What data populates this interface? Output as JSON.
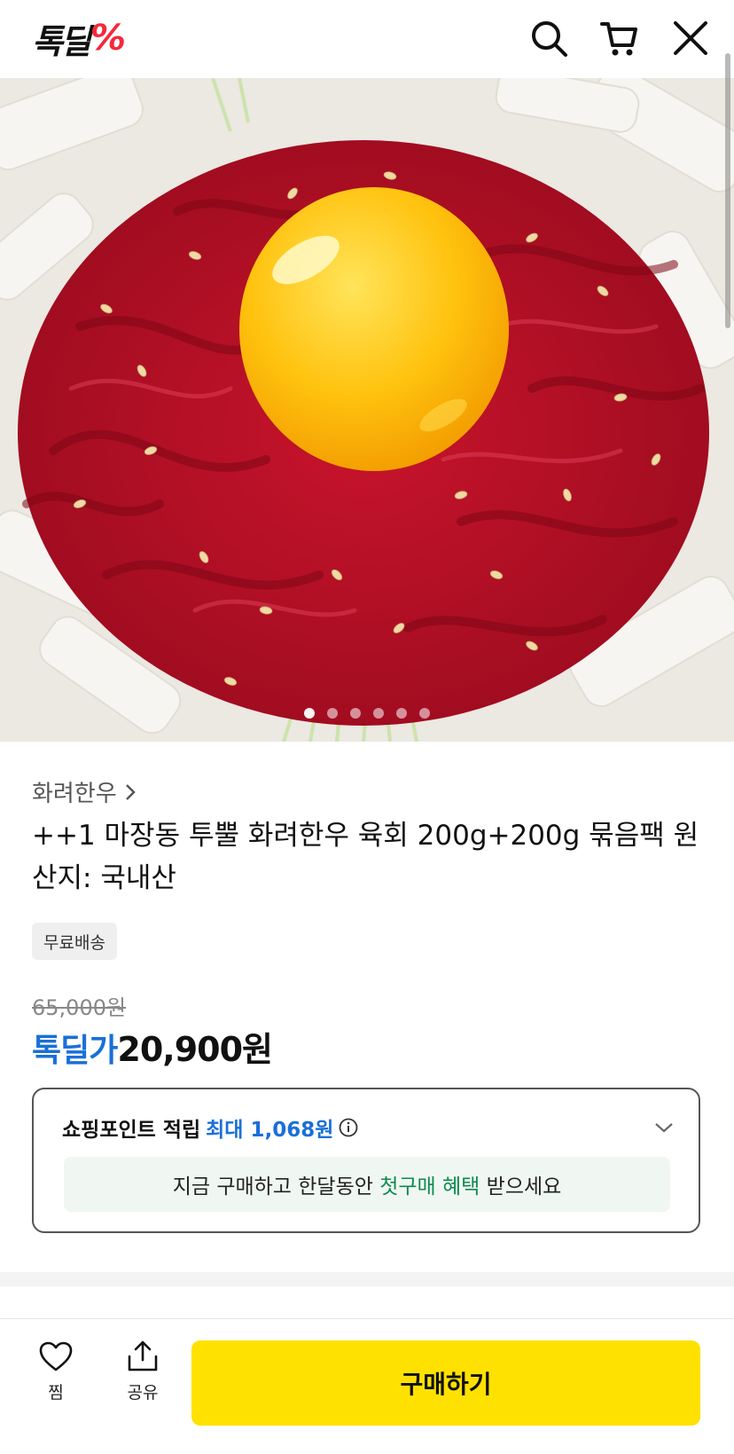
{
  "header": {
    "logo_text": "톡딜",
    "logo_mark": "%",
    "icons": [
      "search-icon",
      "cart-icon",
      "close-icon"
    ]
  },
  "carousel": {
    "count": 6,
    "active_index": 0
  },
  "product": {
    "brand": "화려한우",
    "title": "++1 마장동 투뿔 화려한우 육회 200g+200g 묶음팩 원산지: 국내산",
    "badge": "무료배송",
    "original_price": "65,000원",
    "price_label": "톡딜가",
    "price": "20,900원"
  },
  "points": {
    "label": "쇼핑포인트 적립",
    "max": "최대 1,068원",
    "benefit_prefix": "지금 구매하고 한달동안",
    "benefit_highlight": "첫구매 혜택",
    "benefit_suffix": "받으세요"
  },
  "bottom_bar": {
    "like_label": "찜",
    "share_label": "공유",
    "buy_label": "구매하기"
  },
  "colors": {
    "accent_blue": "#1a6fd8",
    "logo_red": "#f5283c",
    "buy_yellow": "#ffe100",
    "benefit_green": "#0e8a4e"
  }
}
